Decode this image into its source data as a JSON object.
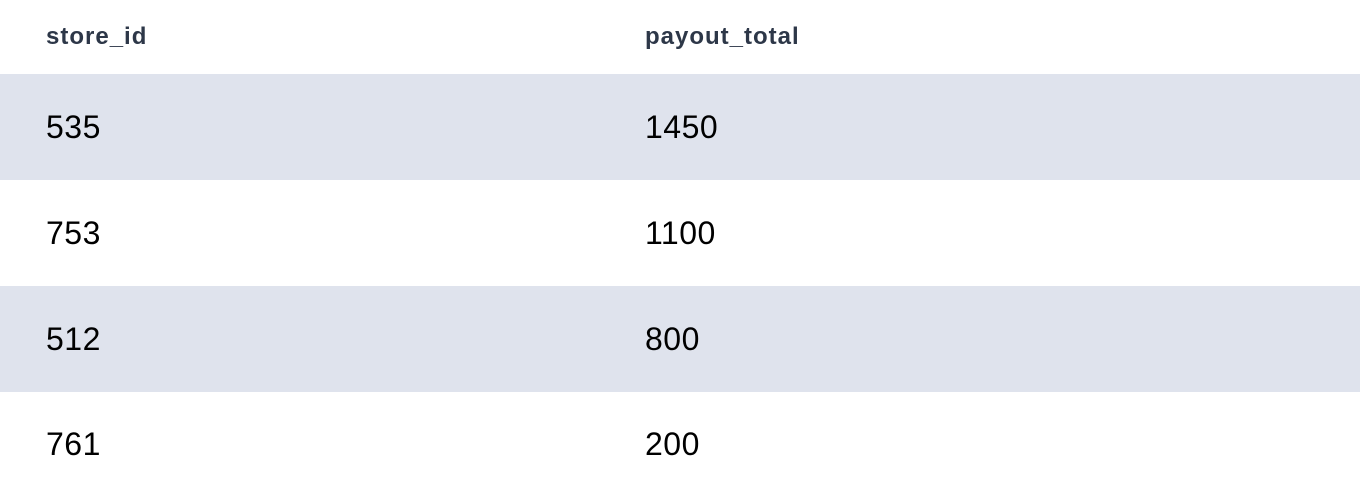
{
  "table": {
    "columns": [
      "store_id",
      "payout_total"
    ],
    "rows": [
      [
        "535",
        "1450"
      ],
      [
        "753",
        "1100"
      ],
      [
        "512",
        "800"
      ],
      [
        "761",
        "200"
      ]
    ]
  },
  "colors": {
    "header_text": "#2d3748",
    "alt_row_bg": "#dfe3ed",
    "body_text": "#000000"
  }
}
